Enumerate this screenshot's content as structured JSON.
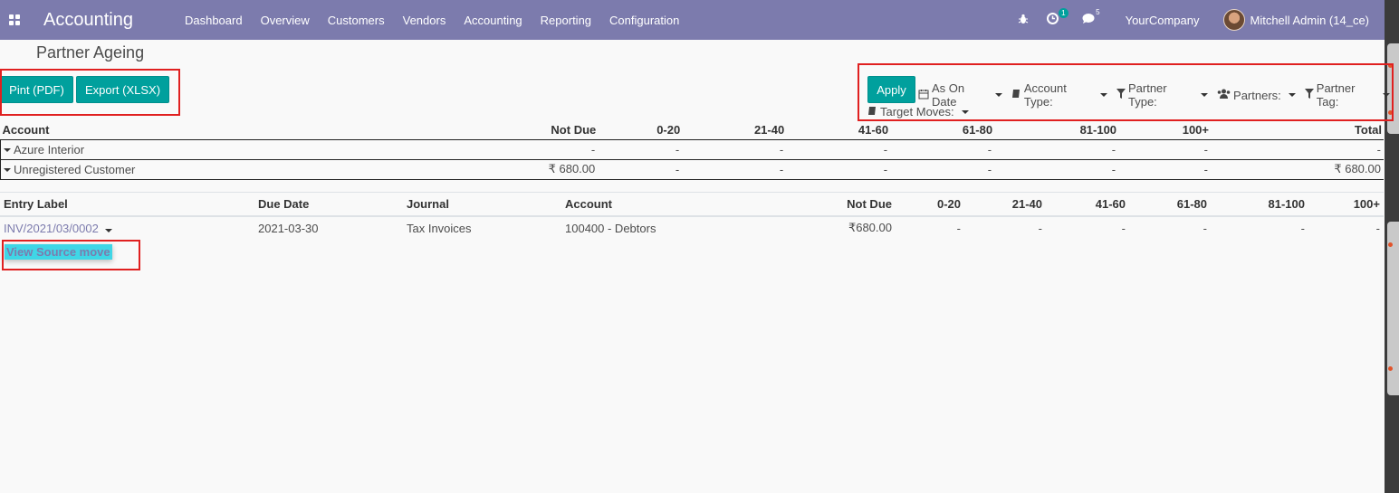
{
  "navbar": {
    "brand": "Accounting",
    "menu": [
      "Dashboard",
      "Overview",
      "Customers",
      "Vendors",
      "Accounting",
      "Reporting",
      "Configuration"
    ],
    "activity_count": "1",
    "messages_count": "5",
    "company": "YourCompany",
    "user": "Mitchell Admin (14_ce)",
    "bg_color": "#7c7bad"
  },
  "page": {
    "title": "Partner Ageing",
    "print_pdf_label": "Pint (PDF)",
    "export_xlsx_label": "Export (XLSX)",
    "apply_label": "Apply",
    "accent_color": "#00a09d"
  },
  "filters": {
    "as_on_date": "As On Date",
    "account_type": "Account Type:",
    "partner_type": "Partner Type:",
    "partners": "Partners:",
    "partner_tag": "Partner Tag:",
    "target_moves": "Target Moves:"
  },
  "summary": {
    "headers": [
      "Account",
      "Not Due",
      "0-20",
      "21-40",
      "41-60",
      "61-80",
      "81-100",
      "100+",
      "Total"
    ],
    "rows": [
      {
        "name": "Azure Interior",
        "values": [
          "-",
          "-",
          "-",
          "-",
          "-",
          "-",
          "-",
          "-"
        ]
      },
      {
        "name": "Unregistered Customer",
        "values": [
          "₹ 680.00",
          "-",
          "-",
          "-",
          "-",
          "-",
          "-",
          "₹ 680.00"
        ]
      }
    ]
  },
  "detail": {
    "headers": [
      "Entry Label",
      "Due Date",
      "Journal",
      "Account",
      "Not Due",
      "0-20",
      "21-40",
      "41-60",
      "61-80",
      "81-100",
      "100+"
    ],
    "rows": [
      {
        "entry": "INV/2021/03/0002",
        "due_date": "2021-03-30",
        "journal": "Tax Invoices",
        "account": "100400 - Debtors",
        "not_due": "₹680.00",
        "b1": "-",
        "b2": "-",
        "b3": "-",
        "b4": "-",
        "b5": "-",
        "b6": "-"
      }
    ],
    "view_source": "View Source move"
  }
}
